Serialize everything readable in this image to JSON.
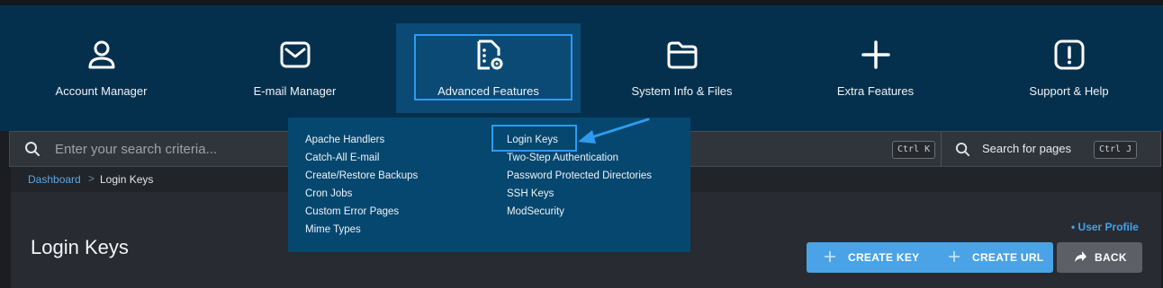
{
  "nav": {
    "items": [
      {
        "label": "Account Manager"
      },
      {
        "label": "E-mail Manager"
      },
      {
        "label": "Advanced Features"
      },
      {
        "label": "System Info & Files"
      },
      {
        "label": "Extra Features"
      },
      {
        "label": "Support & Help"
      }
    ]
  },
  "dropdown": {
    "col1": [
      "Apache Handlers",
      "Catch-All E-mail",
      "Create/Restore Backups",
      "Cron Jobs",
      "Custom Error Pages",
      "Mime Types"
    ],
    "col2": [
      "Login Keys",
      "Two-Step Authentication",
      "Password Protected Directories",
      "SSH Keys",
      "ModSecurity"
    ]
  },
  "search": {
    "placeholder": "Enter your search criteria...",
    "shortcut": "Ctrl K",
    "pages_label": "Search for pages",
    "pages_shortcut": "Ctrl J"
  },
  "breadcrumb": {
    "home": "Dashboard",
    "separator": ">",
    "current": "Login Keys"
  },
  "page": {
    "title": "Login Keys",
    "user_profile": "• User Profile",
    "buttons": {
      "create_key": "CREATE KEY",
      "create_url": "CREATE URL",
      "back": "BACK"
    }
  },
  "colors": {
    "nav_bg": "#05304d",
    "active_bg": "#0a4a75",
    "highlight": "#2f9bf0",
    "button_blue": "#4aa3e6"
  }
}
